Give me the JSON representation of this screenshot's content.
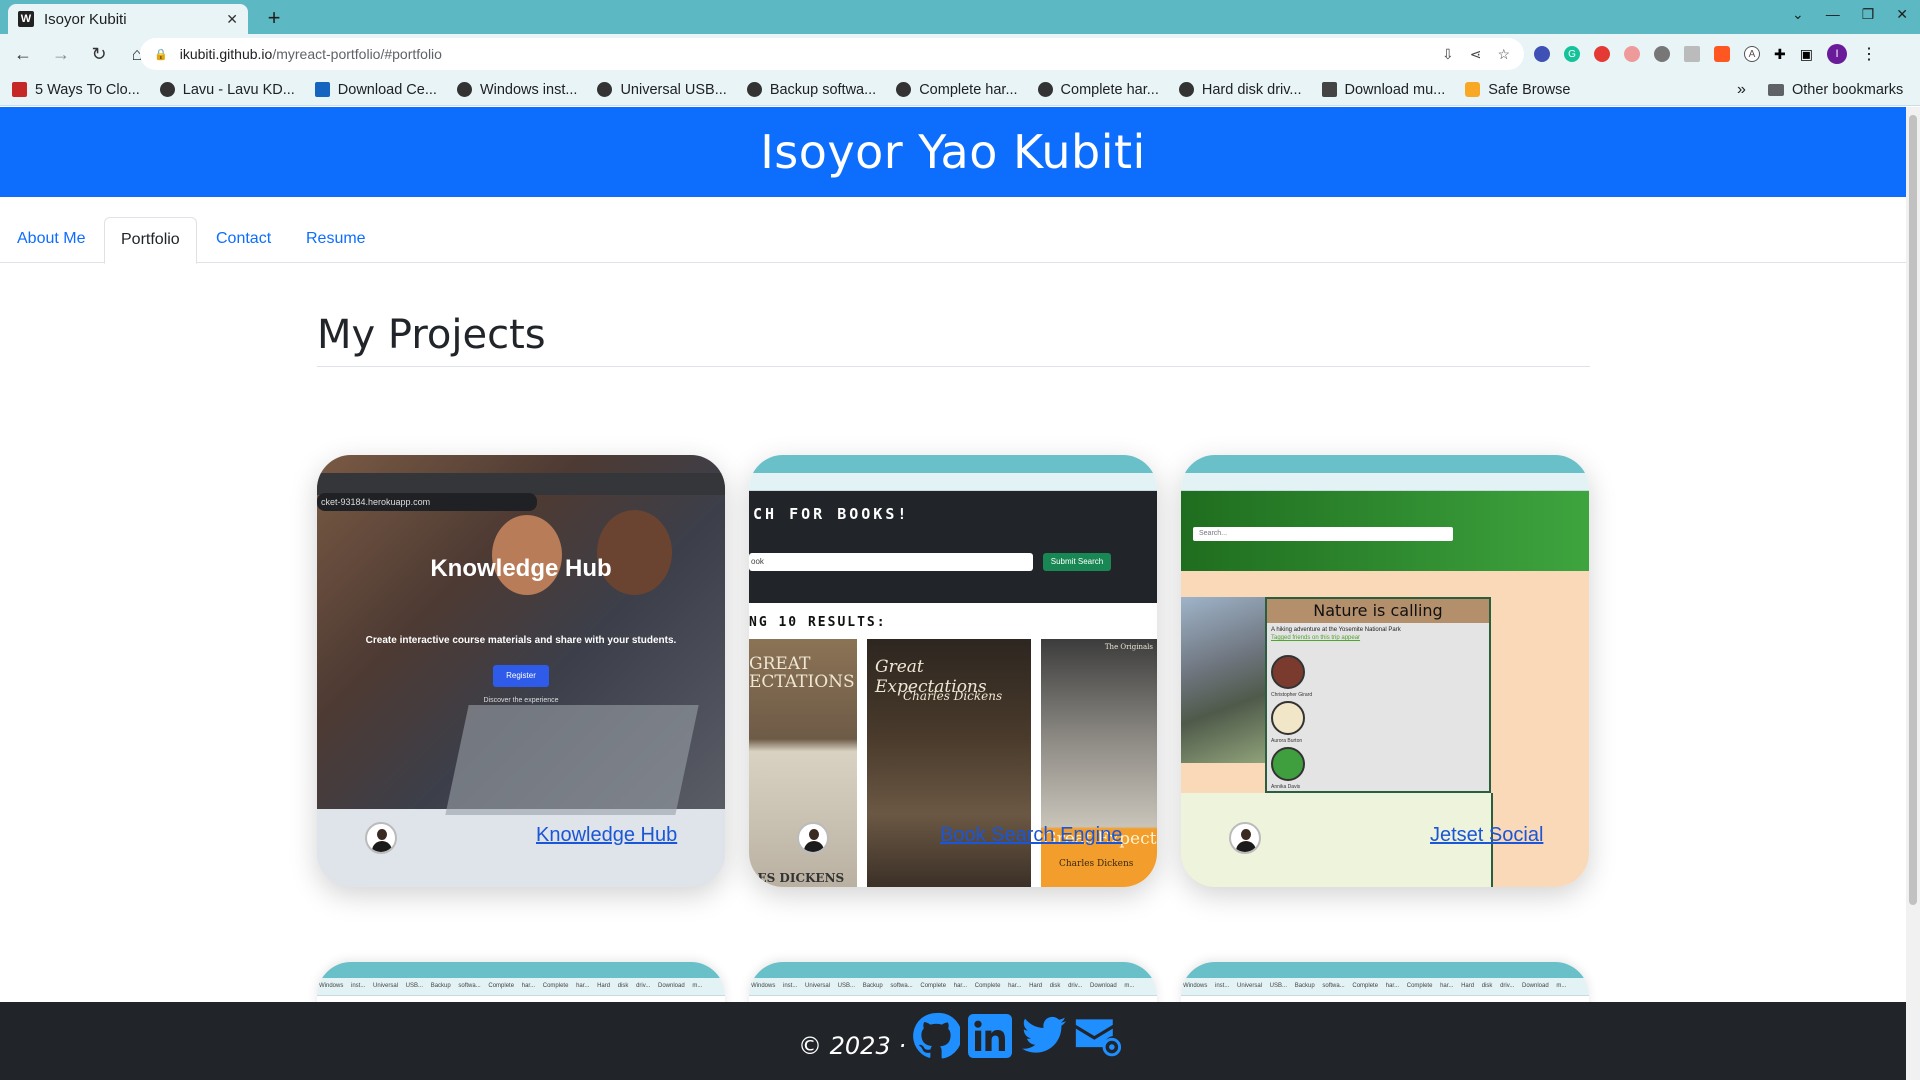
{
  "browser": {
    "tab_title": "Isoyor Kubiti",
    "favicon": "W",
    "url_host": "ikubiti.github.io",
    "url_path": "/myreact-portfolio/#portfolio",
    "bookmarks": [
      {
        "label": "5 Ways To Clo...",
        "icon": "red"
      },
      {
        "label": "Lavu - Lavu KD...",
        "icon": "globe"
      },
      {
        "label": "Download Ce...",
        "icon": "blue"
      },
      {
        "label": "Windows inst...",
        "icon": "globe"
      },
      {
        "label": "Universal USB...",
        "icon": "globe"
      },
      {
        "label": "Backup softwa...",
        "icon": "globe"
      },
      {
        "label": "Complete har...",
        "icon": "globe"
      },
      {
        "label": "Complete har...",
        "icon": "globe"
      },
      {
        "label": "Hard disk driv...",
        "icon": "globe"
      },
      {
        "label": "Download mu...",
        "icon": "dark"
      },
      {
        "label": "Safe Browse",
        "icon": "lock"
      }
    ],
    "bookmarks_more": "»",
    "other_bookmarks": "Other bookmarks",
    "profile_initial": "I"
  },
  "site": {
    "title": "Isoyor Yao Kubiti",
    "nav": [
      {
        "label": "About Me",
        "active": false
      },
      {
        "label": "Portfolio",
        "active": true
      },
      {
        "label": "Contact",
        "active": false
      },
      {
        "label": "Resume",
        "active": false
      }
    ],
    "section_title": "My Projects",
    "projects": [
      {
        "link": "Knowledge Hub",
        "shot": {
          "url": "cket-93184.herokuapp.com",
          "title": "Knowledge Hub",
          "subtitle": "Create interactive course materials and share with your students.",
          "button": "Register",
          "discover": "Discover the experience"
        }
      },
      {
        "link": "Book Search Engine",
        "shot": {
          "heading": "CH FOR BOOKS!",
          "input_value": "ook",
          "button": "Submit Search",
          "results": "NG 10 RESULTS:",
          "book1_text": "GREAT\nECTATIONS",
          "book1_author": "LES DICKENS",
          "book2_title": "Great Expectations",
          "book2_author": "Charles Dickens",
          "book3_top": "The Originals",
          "book3_title": "Great Expectati",
          "book3_author": "Charles Dickens"
        }
      },
      {
        "link": "Jetset Social",
        "shot": {
          "search_placeholder": "Search...",
          "post_title": "Nature is calling",
          "post_desc": "A hiking adventure at the Yosemite National Park",
          "post_tag": "Tagged friends on this trip appear",
          "people": [
            "Christopher Girard",
            "Aurora Burton",
            "Annika Davis"
          ]
        }
      }
    ],
    "peek_bookmarks": "Windows inst...  Universal USB...  Backup softwa...  Complete har...  Complete har...  Hard disk driv...  Download m...",
    "footer": {
      "copyright": "© 2023 ·",
      "socials": [
        "github-icon",
        "linkedin-icon",
        "twitter-icon",
        "email-icon"
      ]
    }
  },
  "colors": {
    "header_blue": "#0d6efd",
    "footer_dark": "#212529",
    "browser_teal": "#5cb8c2"
  }
}
